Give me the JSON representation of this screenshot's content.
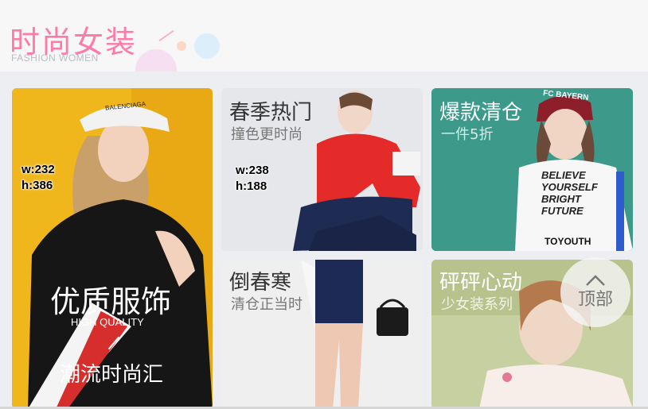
{
  "header": {
    "title": "时尚女装",
    "subtitle": "FASHION WOMEN"
  },
  "cards": {
    "quality": {
      "title": "优质服饰",
      "english": "HIGH QUALITY",
      "slogan": "潮流时尚汇",
      "dim_w": "w:232",
      "dim_h": "h:386",
      "cap_logo": "BALENCIAGA"
    },
    "spring_hot": {
      "title": "春季热门",
      "subtitle": "撞色更时尚",
      "dim_w": "w:238",
      "dim_h": "h:188"
    },
    "clearance": {
      "title": "爆款清仓",
      "subtitle": "一件5折",
      "hat_text": "FC BAYERN",
      "shirt_lines": [
        "BELIEVE",
        "YOURSELF",
        "BRIGHT",
        "FUTURE"
      ],
      "shirt_brand": "TOYOUTH"
    },
    "late_cold": {
      "title": "倒春寒",
      "subtitle": "清仓正当时"
    },
    "heartbeat": {
      "title": "砰砰心动",
      "subtitle": "少女装系列"
    }
  },
  "back_to_top": {
    "label": "顶部",
    "icon": "chevron-up-icon"
  },
  "colors": {
    "title_pink": "#ff7aa5",
    "quality_bg": "#f0b71c",
    "clearance_bg": "#3d9a8b"
  }
}
